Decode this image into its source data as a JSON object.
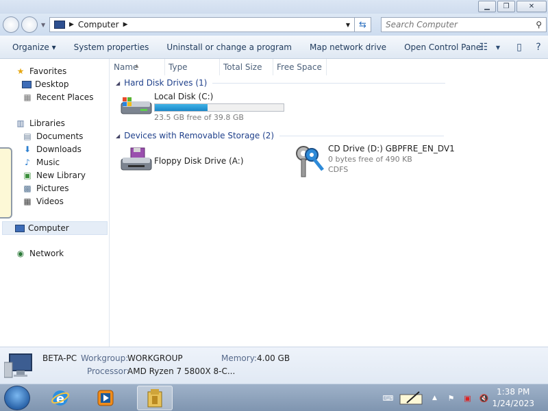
{
  "window": {
    "address_path": "Computer",
    "search_placeholder": "Search Computer"
  },
  "toolbar": {
    "organize": "Organize",
    "system_properties": "System properties",
    "uninstall": "Uninstall or change a program",
    "map_drive": "Map network drive",
    "control_panel": "Open Control Panel"
  },
  "nav": {
    "favorites": "Favorites",
    "desktop": "Desktop",
    "recent_places": "Recent Places",
    "libraries": "Libraries",
    "documents": "Documents",
    "downloads": "Downloads",
    "music": "Music",
    "new_library": "New Library",
    "pictures": "Pictures",
    "videos": "Videos",
    "computer": "Computer",
    "network": "Network"
  },
  "columns": [
    "Name",
    "Type",
    "Total Size",
    "Free Space"
  ],
  "groups": {
    "hard_disk": "Hard Disk Drives (1)",
    "removable": "Devices with Removable Storage (2)"
  },
  "drives": {
    "c": {
      "name": "Local Disk (C:)",
      "free": "23.5 GB free of 39.8 GB",
      "used_fraction": 0.41
    },
    "a": {
      "name": "Floppy Disk Drive (A:)"
    },
    "d": {
      "name": "CD Drive (D:) GBPFRE_EN_DV1",
      "free": "0 bytes free of 490 KB",
      "fs": "CDFS"
    }
  },
  "details": {
    "computer_name": "BETA-PC",
    "workgroup_label": "Workgroup:",
    "workgroup": "WORKGROUP",
    "memory_label": "Memory:",
    "memory": "4.00 GB",
    "processor_label": "Processor:",
    "processor": "AMD Ryzen 7 5800X 8-C..."
  },
  "taskbar": {
    "time": "1:38 PM",
    "date": "1/24/2023"
  }
}
